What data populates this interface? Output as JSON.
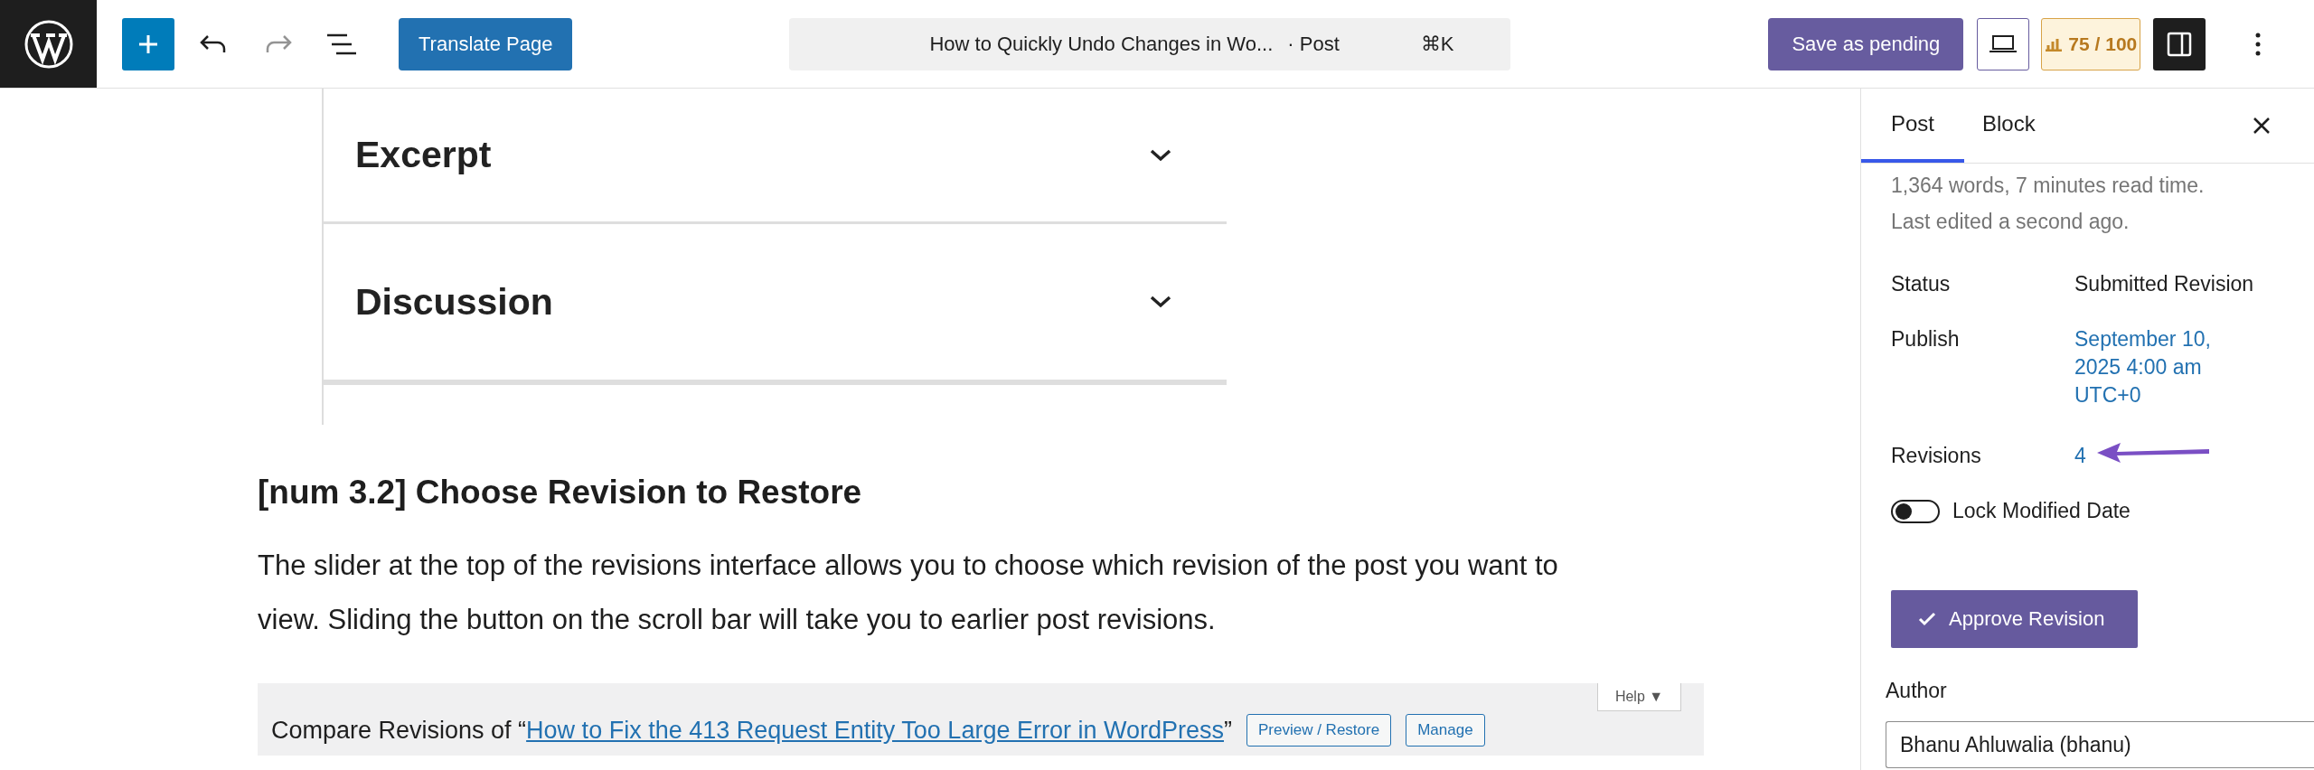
{
  "toolbar": {
    "translate_button": "Translate Page",
    "redo": {
      "disabled": true
    },
    "command_bar": {
      "title": "How to Quickly Undo Changes in Wo...",
      "post_type": "· Post",
      "shortcut": "⌘K"
    },
    "save_button": "Save as pending",
    "seo_score": "75 / 100",
    "sidebar_toggle": {
      "on": true
    }
  },
  "editor": {
    "embedded_panel": {
      "sections": [
        {
          "label": "Excerpt",
          "expanded": false
        },
        {
          "label": "Discussion",
          "expanded": false
        }
      ]
    },
    "heading": "[num 3.2] Choose Revision to Restore",
    "paragraph": "The slider at the top of the revisions interface allows you to choose which revision of the post you want to view. Sliding the button on the scroll bar will take you to earlier post revisions.",
    "revisions_bar": {
      "title_prefix": "Compare Revisions of “",
      "link": "How to Fix the 413 Request Entity Too Large Error in WordPress",
      "title_suffix": "”",
      "buttons": [
        "Preview / Restore",
        "Manage"
      ],
      "help_tab": "Help ▼"
    }
  },
  "sidebar": {
    "tabs": [
      {
        "label": "Post",
        "selected": true
      },
      {
        "label": "Block",
        "selected": false
      }
    ],
    "word_count": "1,364 words, 7 minutes read time.",
    "last_edited": "Last edited a second ago.",
    "fields": [
      {
        "label": "Status",
        "value": "Submitted Revision",
        "kind": "text"
      },
      {
        "label": "Publish",
        "value": "September 10, 2025 4:00 am UTC+0",
        "kind": "link"
      },
      {
        "label": "Revisions",
        "value": "4",
        "kind": "link",
        "annotated": true
      }
    ],
    "lock_modified_date": {
      "label": "Lock Modified Date",
      "on": false
    },
    "approve_button": "Approve Revision",
    "author": {
      "label": "Author",
      "value": "Bhanu Ahluwalia (bhanu)"
    }
  }
}
